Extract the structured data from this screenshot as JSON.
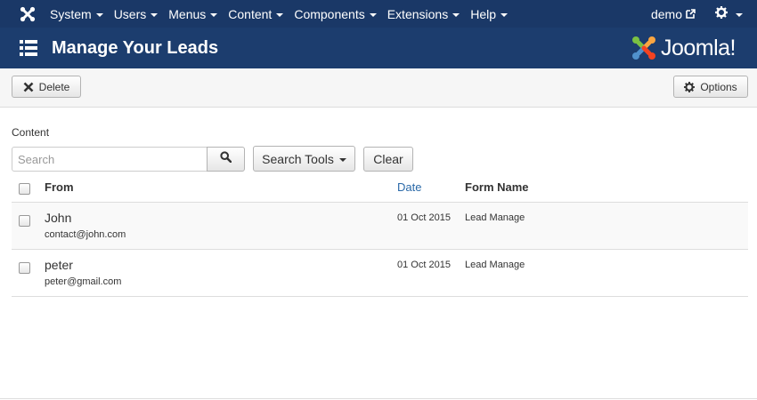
{
  "topnav": {
    "menus": [
      "System",
      "Users",
      "Menus",
      "Content",
      "Components",
      "Extensions",
      "Help"
    ],
    "user": "demo"
  },
  "header": {
    "title": "Manage Your Leads",
    "logo_text": "Joomla!"
  },
  "toolbar": {
    "delete_label": "Delete",
    "options_label": "Options"
  },
  "filters": {
    "content_label": "Content",
    "search_placeholder": "Search",
    "search_value": "",
    "search_tools_label": "Search Tools",
    "clear_label": "Clear"
  },
  "table": {
    "columns": {
      "from": "From",
      "date": "Date",
      "form_name": "Form Name"
    },
    "rows": [
      {
        "name": "John",
        "email": "contact@john.com",
        "date": "01 Oct 2015",
        "form": "Lead Manage"
      },
      {
        "name": "peter",
        "email": "peter@gmail.com",
        "date": "01 Oct 2015",
        "form": "Lead Manage"
      }
    ]
  },
  "colors": {
    "topnav_bg": "#1a3867",
    "header_bg": "#1c3d6e",
    "link": "#2a69a8"
  }
}
